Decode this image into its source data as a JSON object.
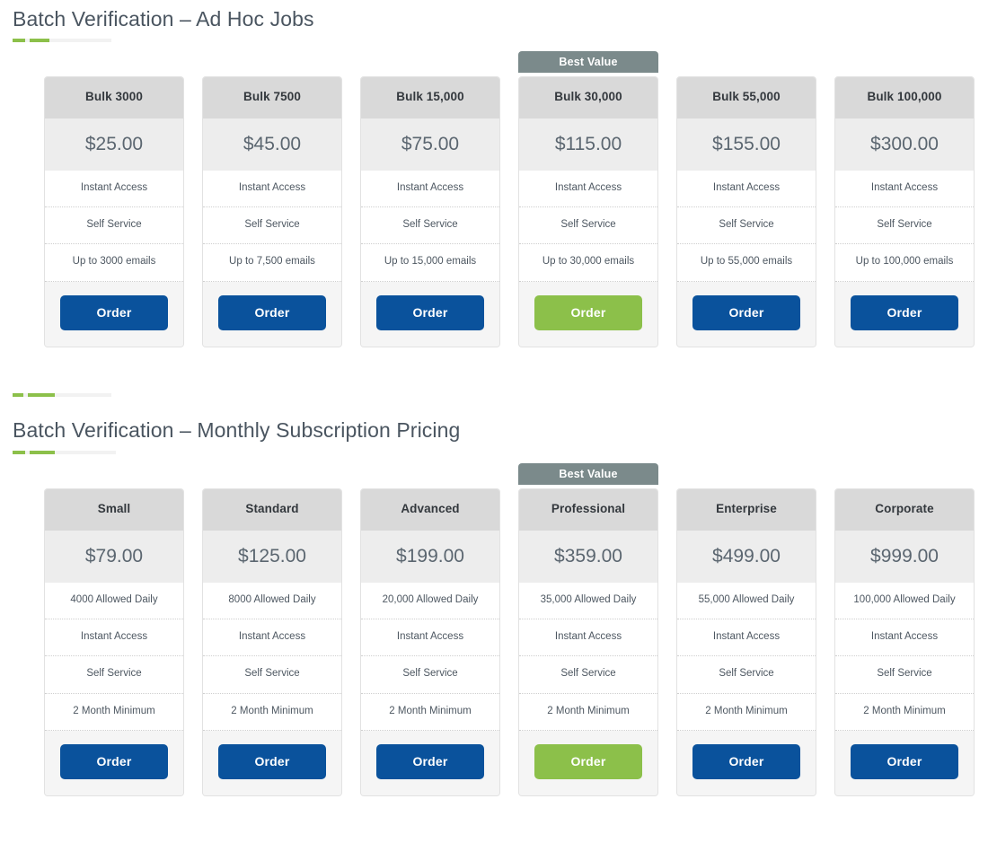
{
  "sections": [
    {
      "title": "Batch Verification – Ad Hoc Jobs",
      "best_value_label": "Best Value",
      "plans": [
        {
          "name": "Bulk 3000",
          "price": "$25.00",
          "features": [
            "Instant Access",
            "Self Service",
            "Up to 3000 emails"
          ],
          "order_label": "Order",
          "highlighted": false
        },
        {
          "name": "Bulk 7500",
          "price": "$45.00",
          "features": [
            "Instant Access",
            "Self Service",
            "Up to 7,500 emails"
          ],
          "order_label": "Order",
          "highlighted": false
        },
        {
          "name": "Bulk 15,000",
          "price": "$75.00",
          "features": [
            "Instant Access",
            "Self Service",
            "Up to 15,000 emails"
          ],
          "order_label": "Order",
          "highlighted": false
        },
        {
          "name": "Bulk 30,000",
          "price": "$115.00",
          "features": [
            "Instant Access",
            "Self Service",
            "Up to 30,000 emails"
          ],
          "order_label": "Order",
          "highlighted": true
        },
        {
          "name": "Bulk 55,000",
          "price": "$155.00",
          "features": [
            "Instant Access",
            "Self Service",
            "Up to 55,000 emails"
          ],
          "order_label": "Order",
          "highlighted": false
        },
        {
          "name": "Bulk 100,000",
          "price": "$300.00",
          "features": [
            "Instant Access",
            "Self Service",
            "Up to 100,000 emails"
          ],
          "order_label": "Order",
          "highlighted": false
        }
      ]
    },
    {
      "title": "Batch Verification – Monthly Subscription Pricing",
      "best_value_label": "Best Value",
      "plans": [
        {
          "name": "Small",
          "price": "$79.00",
          "features": [
            "4000 Allowed Daily",
            "Instant Access",
            "Self Service",
            "2 Month Minimum"
          ],
          "order_label": "Order",
          "highlighted": false
        },
        {
          "name": "Standard",
          "price": "$125.00",
          "features": [
            "8000 Allowed Daily",
            "Instant Access",
            "Self Service",
            "2 Month Minimum"
          ],
          "order_label": "Order",
          "highlighted": false
        },
        {
          "name": "Advanced",
          "price": "$199.00",
          "features": [
            "20,000 Allowed Daily",
            "Instant Access",
            "Self Service",
            "2 Month Minimum"
          ],
          "order_label": "Order",
          "highlighted": false
        },
        {
          "name": "Professional",
          "price": "$359.00",
          "features": [
            "35,000 Allowed Daily",
            "Instant Access",
            "Self Service",
            "2 Month Minimum"
          ],
          "order_label": "Order",
          "highlighted": true
        },
        {
          "name": "Enterprise",
          "price": "$499.00",
          "features": [
            "55,000 Allowed Daily",
            "Instant Access",
            "Self Service",
            "2 Month Minimum"
          ],
          "order_label": "Order",
          "highlighted": false
        },
        {
          "name": "Corporate",
          "price": "$999.00",
          "features": [
            "100,000 Allowed Daily",
            "Instant Access",
            "Self Service",
            "2 Month Minimum"
          ],
          "order_label": "Order",
          "highlighted": false
        }
      ]
    }
  ],
  "colors": {
    "accent_green": "#8cc04a",
    "order_blue": "#0a529c",
    "badge_gray": "#7b8a8b",
    "card_header_gray": "#d9d9d9",
    "card_price_gray": "#ededed"
  }
}
